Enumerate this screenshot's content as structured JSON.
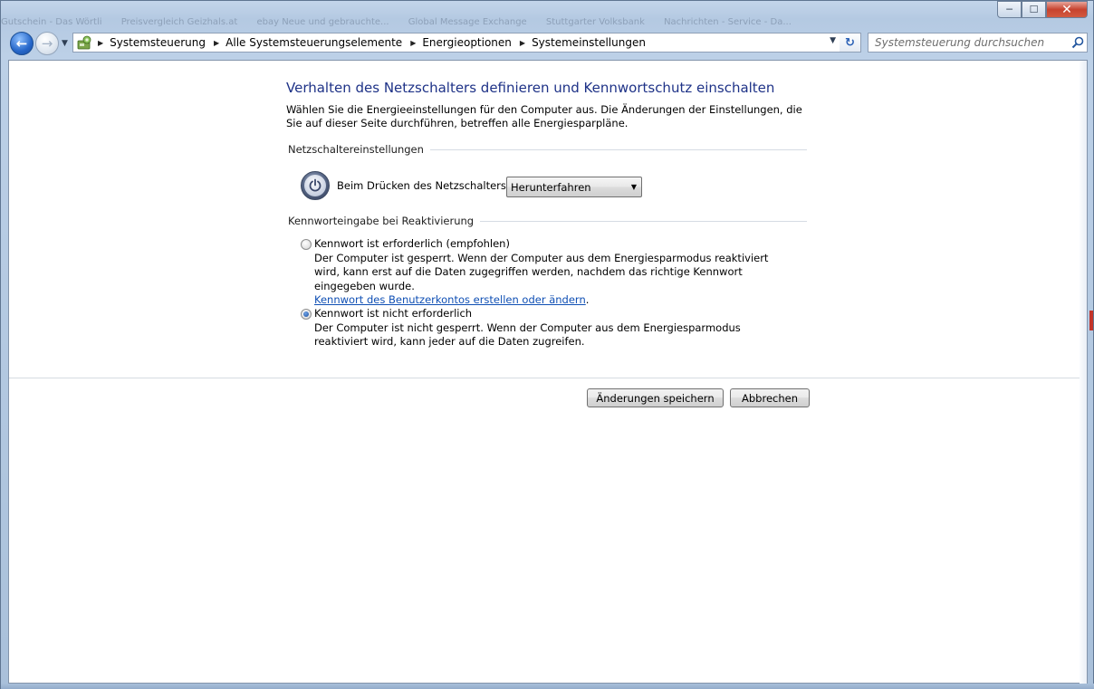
{
  "window": {
    "caption_buttons": {
      "minimize": "─",
      "maximize": "☐",
      "close": "✕"
    },
    "ghost_tabs": [
      "Gutschein - Das Wörtli",
      "Preisvergleich Geizhals.at",
      "ebay Neue und gebrauchte...",
      "Global Message Exchange",
      "Stuttgarter Volksbank",
      "Nachrichten - Service - Da..."
    ]
  },
  "nav": {
    "back_symbol": "←",
    "forward_symbol": "→",
    "breadcrumbs": [
      "Systemsteuerung",
      "Alle Systemsteuerungselemente",
      "Energieoptionen",
      "Systemeinstellungen"
    ],
    "refresh_symbol": "↻",
    "search_placeholder": "Systemsteuerung durchsuchen"
  },
  "page": {
    "title": "Verhalten des Netzschalters definieren und Kennwortschutz einschalten",
    "description": "Wählen Sie die Energieeinstellungen für den Computer aus. Die Änderungen der Einstellungen, die Sie auf dieser Seite durchführen, betreffen alle Energiesparpläne.",
    "power_section": {
      "heading": "Netzschaltereinstellungen",
      "label": "Beim Drücken des Netzschalters:",
      "selected": "Herunterfahren"
    },
    "password_section": {
      "heading": "Kennworteingabe bei Reaktivierung",
      "options": [
        {
          "label": "Kennwort ist erforderlich (empfohlen)",
          "description": "Der Computer ist gesperrt. Wenn der Computer aus dem Energiesparmodus reaktiviert wird, kann erst auf die Daten zugegriffen werden, nachdem das richtige Kennwort eingegeben wurde.",
          "link": "Kennwort des Benutzerkontos erstellen oder ändern",
          "link_suffix": ".",
          "checked": false
        },
        {
          "label": "Kennwort ist nicht erforderlich",
          "description": "Der Computer ist nicht gesperrt. Wenn der Computer aus dem Energiesparmodus reaktiviert wird, kann jeder auf die Daten zugreifen.",
          "checked": true
        }
      ]
    },
    "buttons": {
      "save": "Änderungen speichern",
      "cancel": "Abbrechen"
    }
  }
}
